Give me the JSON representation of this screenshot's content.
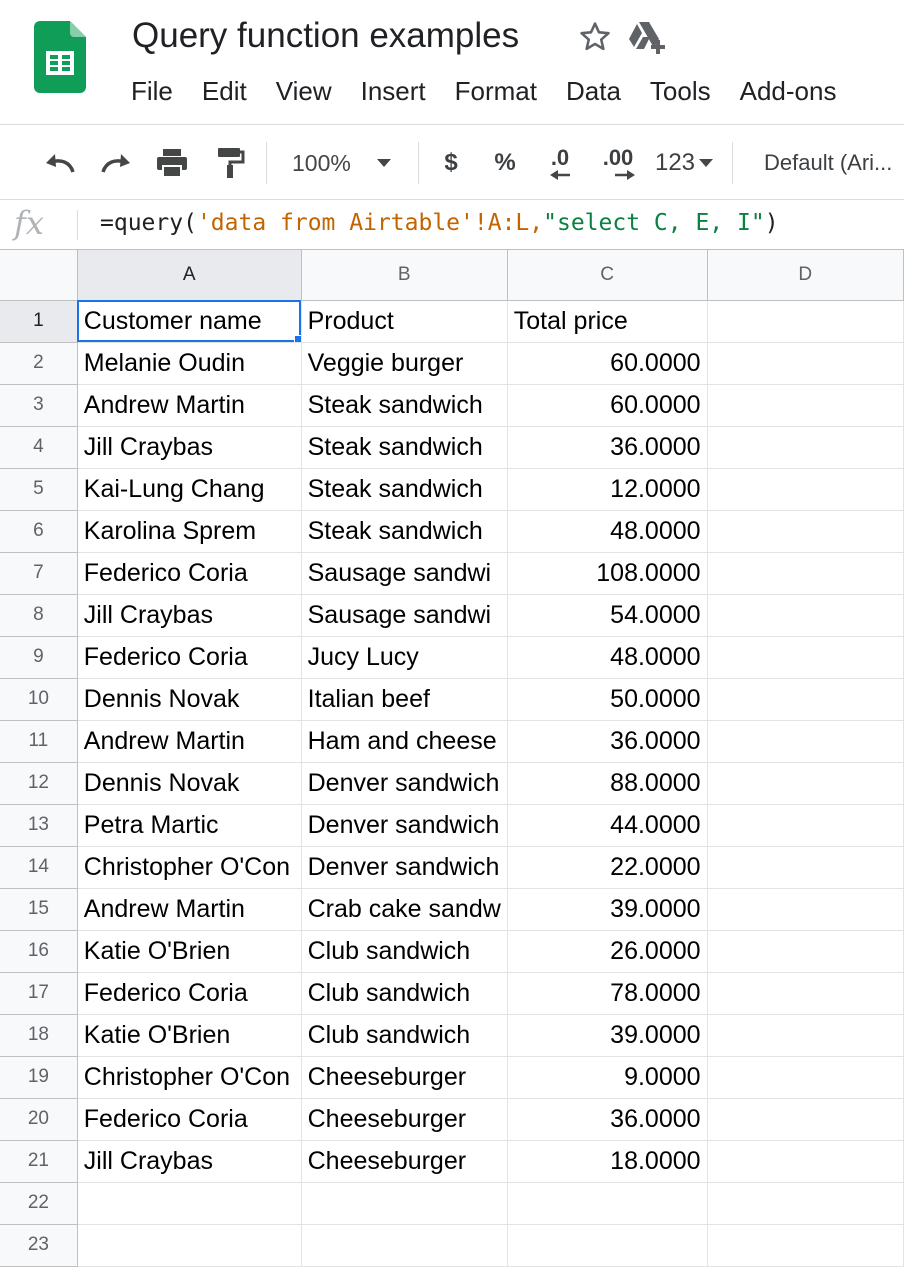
{
  "app": {
    "title": "Query function examples",
    "logo_icon": "google-sheets-logo",
    "star_icon": "star-outline-icon",
    "drive_icon": "drive-add-icon"
  },
  "menu": [
    "File",
    "Edit",
    "View",
    "Insert",
    "Format",
    "Data",
    "Tools",
    "Add-ons"
  ],
  "toolbar": {
    "undo_icon": "undo-icon",
    "redo_icon": "redo-icon",
    "print_icon": "print-icon",
    "paint_format_icon": "paint-format-icon",
    "zoom": "100%",
    "currency": "$",
    "percent": "%",
    "decrease_decimal": ".0",
    "increase_decimal": ".00",
    "number_format": "123",
    "font": "Default (Ari..."
  },
  "formula_bar": {
    "fx": "fx",
    "parts": [
      "=query(",
      "'data from Airtable'",
      "!A:L,",
      "\"select C, E, I\"",
      ")"
    ]
  },
  "grid": {
    "columns": [
      "A",
      "B",
      "C",
      "D"
    ],
    "rows": [
      {
        "n": "1",
        "a": "Customer name",
        "b": "Product",
        "c": "Total price"
      },
      {
        "n": "2",
        "a": "Melanie Oudin",
        "b": "Veggie burger",
        "c": "60.0000"
      },
      {
        "n": "3",
        "a": "Andrew Martin",
        "b": "Steak sandwich",
        "c": "60.0000"
      },
      {
        "n": "4",
        "a": "Jill Craybas",
        "b": "Steak sandwich",
        "c": "36.0000"
      },
      {
        "n": "5",
        "a": "Kai-Lung Chang",
        "b": "Steak sandwich",
        "c": "12.0000"
      },
      {
        "n": "6",
        "a": "Karolina Sprem",
        "b": "Steak sandwich",
        "c": "48.0000"
      },
      {
        "n": "7",
        "a": "Federico Coria",
        "b": "Sausage sandwi",
        "c": "108.0000"
      },
      {
        "n": "8",
        "a": "Jill Craybas",
        "b": "Sausage sandwi",
        "c": "54.0000"
      },
      {
        "n": "9",
        "a": "Federico Coria",
        "b": "Jucy Lucy",
        "c": "48.0000"
      },
      {
        "n": "10",
        "a": "Dennis Novak",
        "b": "Italian beef",
        "c": "50.0000"
      },
      {
        "n": "11",
        "a": "Andrew Martin",
        "b": "Ham and cheese",
        "c": "36.0000"
      },
      {
        "n": "12",
        "a": "Dennis Novak",
        "b": "Denver sandwich",
        "c": "88.0000"
      },
      {
        "n": "13",
        "a": "Petra Martic",
        "b": "Denver sandwich",
        "c": "44.0000"
      },
      {
        "n": "14",
        "a": "Christopher O'Con",
        "b": "Denver sandwich",
        "c": "22.0000"
      },
      {
        "n": "15",
        "a": "Andrew Martin",
        "b": "Crab cake sandw",
        "c": "39.0000"
      },
      {
        "n": "16",
        "a": "Katie O'Brien",
        "b": "Club sandwich",
        "c": "26.0000"
      },
      {
        "n": "17",
        "a": "Federico Coria",
        "b": "Club sandwich",
        "c": "78.0000"
      },
      {
        "n": "18",
        "a": "Katie O'Brien",
        "b": "Club sandwich",
        "c": "39.0000"
      },
      {
        "n": "19",
        "a": "Christopher O'Con",
        "b": "Cheeseburger",
        "c": "9.0000"
      },
      {
        "n": "20",
        "a": "Federico Coria",
        "b": "Cheeseburger",
        "c": "36.0000"
      },
      {
        "n": "21",
        "a": "Jill Craybas",
        "b": "Cheeseburger",
        "c": "18.0000"
      },
      {
        "n": "22",
        "a": "",
        "b": "",
        "c": ""
      },
      {
        "n": "23",
        "a": "",
        "b": "",
        "c": ""
      }
    ]
  },
  "colors": {
    "accent": "#1a73e8",
    "sheets_green": "#0f9d58"
  }
}
